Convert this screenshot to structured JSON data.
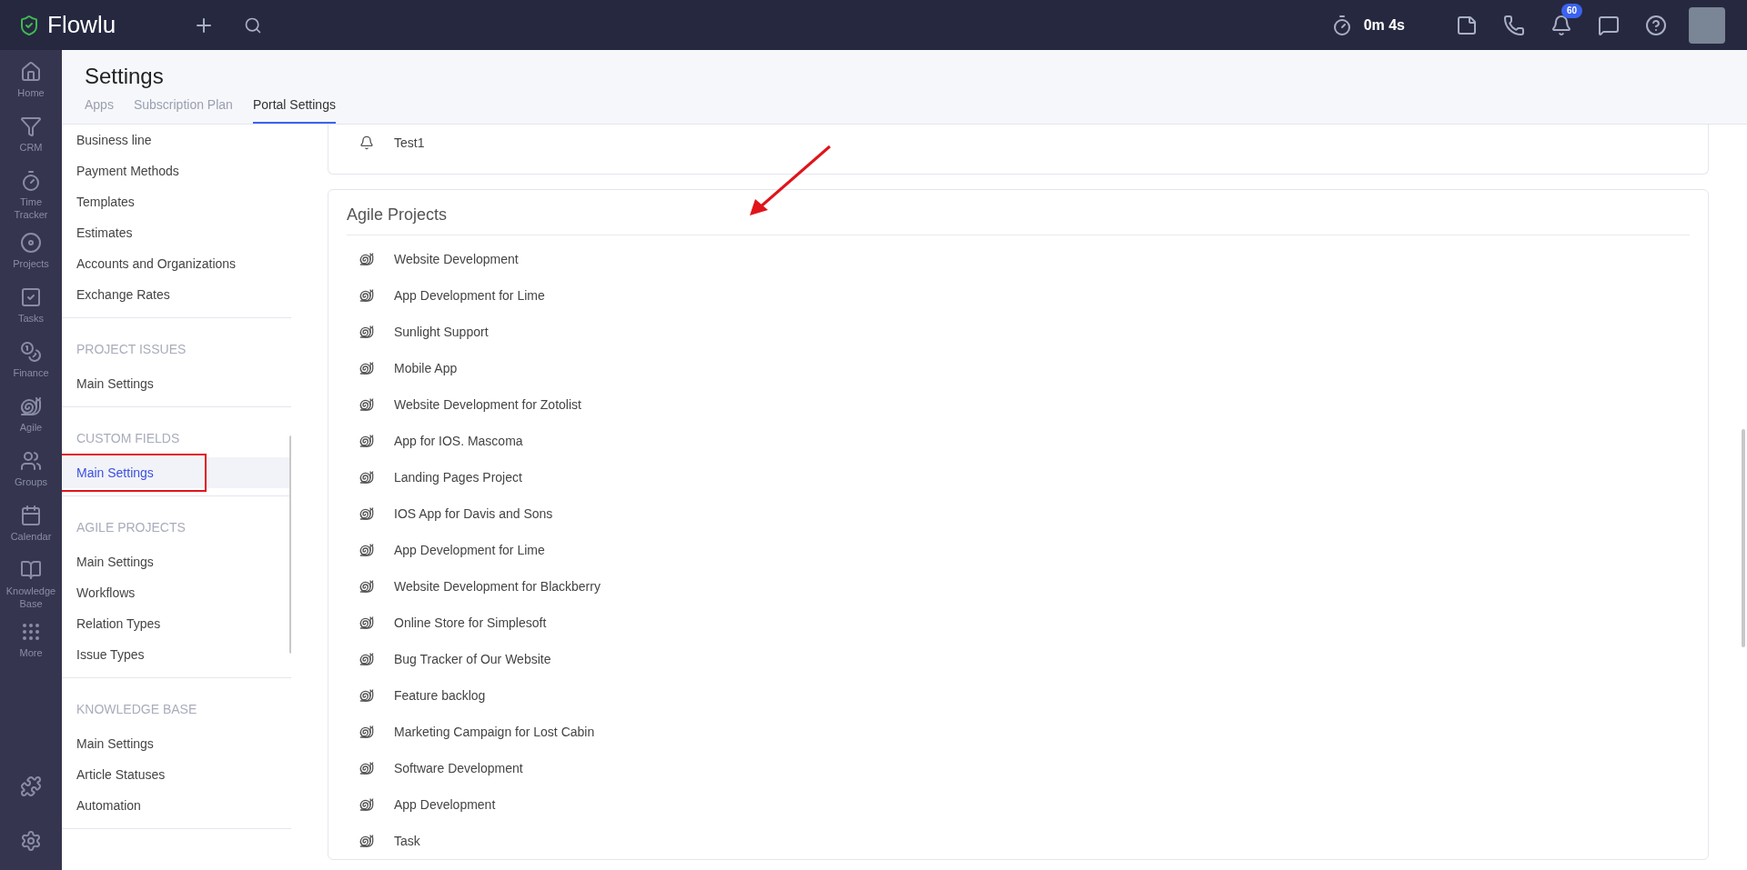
{
  "topbar": {
    "logo": "Flowlu",
    "timer": "0m 4s",
    "notifications_badge": "60"
  },
  "rail": {
    "items": [
      {
        "label": "Home",
        "kind": "home"
      },
      {
        "label": "CRM",
        "kind": "crm"
      },
      {
        "label": "Time Tracker",
        "kind": "timer"
      },
      {
        "label": "Projects",
        "kind": "projects"
      },
      {
        "label": "Tasks",
        "kind": "tasks"
      },
      {
        "label": "Finance",
        "kind": "finance"
      },
      {
        "label": "Agile",
        "kind": "agile"
      },
      {
        "label": "Groups",
        "kind": "groups"
      },
      {
        "label": "Calendar",
        "kind": "calendar"
      },
      {
        "label": "Knowledge Base",
        "kind": "kb"
      },
      {
        "label": "More",
        "kind": "more"
      }
    ]
  },
  "header": {
    "title": "Settings",
    "tabs": [
      {
        "label": "Apps",
        "selected": false
      },
      {
        "label": "Subscription Plan",
        "selected": false
      },
      {
        "label": "Portal Settings",
        "selected": true
      }
    ]
  },
  "sidebar": {
    "sections": [
      {
        "items": [
          {
            "label": "Business line",
            "selected": false
          },
          {
            "label": "Payment Methods",
            "selected": false
          },
          {
            "label": "Templates",
            "selected": false
          },
          {
            "label": "Estimates",
            "selected": false
          },
          {
            "label": "Accounts and Organizations",
            "selected": false
          },
          {
            "label": "Exchange Rates",
            "selected": false
          }
        ]
      },
      {
        "heading": "PROJECT ISSUES",
        "items": [
          {
            "label": "Main Settings",
            "selected": false
          }
        ]
      },
      {
        "heading": "CUSTOM FIELDS",
        "items": [
          {
            "label": "Main Settings",
            "selected": true
          }
        ]
      },
      {
        "heading": "AGILE PROJECTS",
        "items": [
          {
            "label": "Main Settings",
            "selected": false
          },
          {
            "label": "Workflows",
            "selected": false
          },
          {
            "label": "Relation Types",
            "selected": false
          },
          {
            "label": "Issue Types",
            "selected": false
          }
        ]
      },
      {
        "heading": "KNOWLEDGE BASE",
        "items": [
          {
            "label": "Main Settings",
            "selected": false
          },
          {
            "label": "Article Statuses",
            "selected": false
          },
          {
            "label": "Automation",
            "selected": false
          }
        ]
      }
    ]
  },
  "cards": [
    {
      "items": [
        {
          "label": "Test1",
          "kind": "notification"
        }
      ]
    },
    {
      "title": "Agile Projects",
      "items": [
        {
          "label": "Website Development",
          "kind": "agile"
        },
        {
          "label": "App Development for Lime",
          "kind": "agile"
        },
        {
          "label": "Sunlight Support",
          "kind": "agile"
        },
        {
          "label": "Mobile App",
          "kind": "agile"
        },
        {
          "label": "Website Development for Zotolist",
          "kind": "agile"
        },
        {
          "label": "App for IOS. Mascoma",
          "kind": "agile"
        },
        {
          "label": "Landing Pages Project",
          "kind": "agile"
        },
        {
          "label": "IOS App for Davis and Sons",
          "kind": "agile"
        },
        {
          "label": "App Development for Lime",
          "kind": "agile"
        },
        {
          "label": "Website Development for Blackberry",
          "kind": "agile"
        },
        {
          "label": "Online Store for Simplesoft",
          "kind": "agile"
        },
        {
          "label": "Bug Tracker of Our Website",
          "kind": "agile"
        },
        {
          "label": "Feature backlog",
          "kind": "agile"
        },
        {
          "label": "Marketing Campaign for Lost Cabin",
          "kind": "agile"
        },
        {
          "label": "Software Development",
          "kind": "agile"
        },
        {
          "label": "App Development",
          "kind": "agile"
        },
        {
          "label": "Task",
          "kind": "agile"
        }
      ]
    }
  ]
}
